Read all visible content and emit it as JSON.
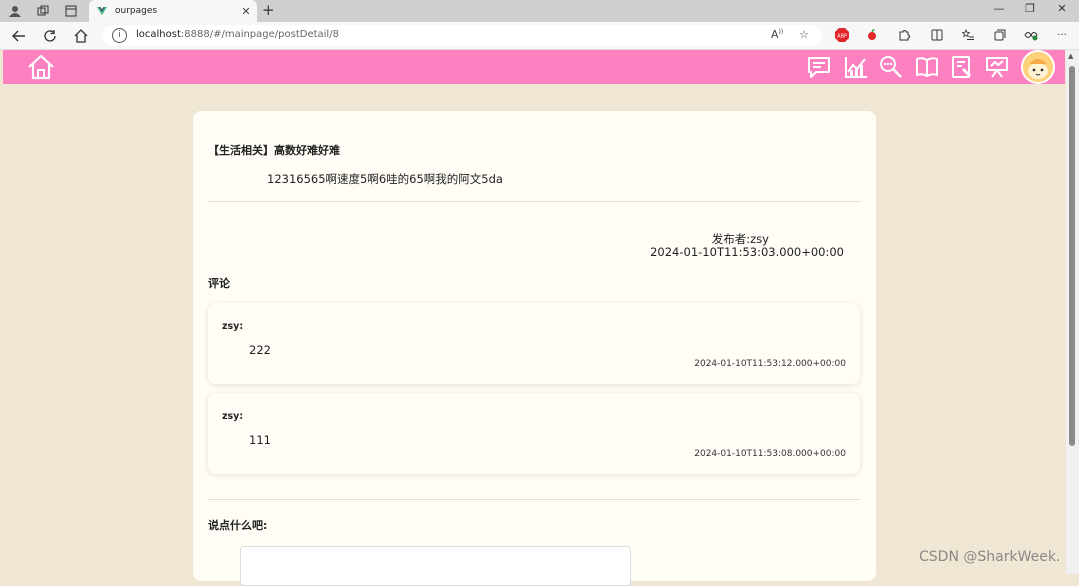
{
  "browser": {
    "tab_title": "ourpages",
    "tab_close": "✕",
    "new_tab": "+",
    "url_host": "localhost",
    "url_rest": ":8888/#/mainpage/postDetail/8",
    "minimize": "—",
    "restore": "❐",
    "close": "✕"
  },
  "post": {
    "title": "【生活相关】高数好难好难",
    "body": "12316565啊速度5啊6哇的65啊我的阿文5da",
    "publisher": "发布者:zsy",
    "publish_time": "2024-01-10T11:53:03.000+00:00"
  },
  "comments_heading": "评论",
  "comments": [
    {
      "author": "zsy:",
      "body": "222",
      "time": "2024-01-10T11:53:12.000+00:00"
    },
    {
      "author": "zsy:",
      "body": "111",
      "time": "2024-01-10T11:53:08.000+00:00"
    }
  ],
  "compose": {
    "heading": "说点什么吧:",
    "placeholder": ""
  },
  "watermark": "CSDN @SharkWeek.",
  "colors": {
    "header": "#fd81c1",
    "page_bg": "#efe6d3",
    "card_bg": "#fffdf6",
    "icon": "#ffffff"
  },
  "header_icons": [
    "chat-icon",
    "chart-icon",
    "search-icon",
    "book-icon",
    "document-icon",
    "presentation-icon"
  ]
}
